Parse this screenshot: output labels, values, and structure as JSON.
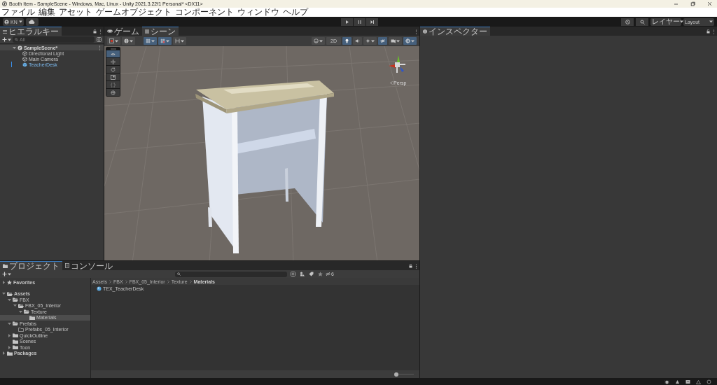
{
  "window": {
    "title": "Booth Item - SampleScene - Windows, Mac, Linux - Unity 2021.3.22f1 Personal* <DX11>"
  },
  "menu": [
    "ファイル",
    "編集",
    "アセット",
    "ゲームオブジェクト",
    "コンポーネント",
    "ウィンドウ",
    "ヘルプ"
  ],
  "toolbar": {
    "account": "KN",
    "layers": "レイヤー",
    "layout": "Layout"
  },
  "hierarchy": {
    "tab": "ヒエラルキー",
    "search_placeholder": "All",
    "tree": [
      {
        "label": "SampleScene*",
        "kind": "scene",
        "expanded": true,
        "modified": false,
        "children": [
          {
            "label": "Directional Light",
            "kind": "object",
            "modified": false
          },
          {
            "label": "Main Camera",
            "kind": "object",
            "modified": false
          },
          {
            "label": "TeacherDesk",
            "kind": "prefab",
            "modified": true
          }
        ]
      }
    ]
  },
  "scene": {
    "tabs": [
      {
        "label": "ゲーム",
        "kind": "game",
        "selected": false
      },
      {
        "label": "シーン",
        "kind": "scene",
        "selected": true
      }
    ],
    "toolbar": [
      {
        "kind": "drawmode",
        "dropdown": true,
        "selected": false
      },
      {
        "kind": "layers",
        "dropdown": true,
        "selected": false
      },
      {
        "kind": "gridsnap",
        "dropdown": true,
        "selected": true
      },
      {
        "kind": "incsnap",
        "dropdown": true,
        "selected": true
      },
      {
        "kind": "align",
        "dropdown": true,
        "selected": false
      },
      {
        "kind": "shading",
        "dropdown": true,
        "selected": false
      },
      {
        "kind": "mode2d",
        "label": "2D",
        "dropdown": false,
        "selected": false
      },
      {
        "kind": "lighting",
        "dropdown": false,
        "selected": true
      },
      {
        "kind": "audio",
        "dropdown": false,
        "selected": false
      },
      {
        "kind": "effects",
        "dropdown": true,
        "selected": false
      },
      {
        "kind": "visibility",
        "dropdown": false,
        "selected": true
      },
      {
        "kind": "camera",
        "dropdown": true,
        "selected": false
      },
      {
        "kind": "gizmos",
        "dropdown": true,
        "selected": true
      }
    ],
    "tools": [
      {
        "kind": "view",
        "selected": true
      },
      {
        "kind": "move",
        "selected": false
      },
      {
        "kind": "rotate",
        "selected": false
      },
      {
        "kind": "scale",
        "selected": false
      },
      {
        "kind": "rect",
        "selected": false
      },
      {
        "kind": "transform",
        "selected": false
      }
    ],
    "projection": "Persp"
  },
  "inspector": {
    "tab": "インスペクター"
  },
  "project": {
    "tabs": [
      {
        "label": "プロジェクト",
        "kind": "project",
        "selected": true
      },
      {
        "label": "コンソール",
        "kind": "console",
        "selected": false
      }
    ],
    "tree": [
      {
        "label": "Favorites",
        "kind": "favorites",
        "expandable": true,
        "expanded": false,
        "selected": false
      },
      {
        "label": "Assets",
        "kind": "root",
        "expandable": true,
        "expanded": true,
        "selected": false,
        "children": [
          {
            "label": "FBX",
            "kind": "folder",
            "expandable": true,
            "expanded": true,
            "selected": false,
            "children": [
              {
                "label": "FBX_05_Interior",
                "kind": "folder",
                "expandable": true,
                "expanded": true,
                "selected": false,
                "children": [
                  {
                    "label": "Texture",
                    "kind": "folder",
                    "expandable": true,
                    "expanded": true,
                    "selected": false,
                    "children": [
                      {
                        "label": "Materials",
                        "kind": "folder",
                        "expandable": false,
                        "expanded": false,
                        "selected": true
                      }
                    ]
                  }
                ]
              }
            ]
          },
          {
            "label": "Prefabs",
            "kind": "folder",
            "expandable": true,
            "expanded": true,
            "selected": false,
            "children": [
              {
                "label": "Prefabs_05_Interior",
                "kind": "empty",
                "expandable": false,
                "expanded": false,
                "selected": false
              }
            ]
          },
          {
            "label": "QuickOutline",
            "kind": "folder",
            "expandable": true,
            "expanded": false,
            "selected": false
          },
          {
            "label": "Scenes",
            "kind": "folder",
            "expandable": false,
            "expanded": false,
            "selected": false
          },
          {
            "label": "Toon",
            "kind": "folder",
            "expandable": true,
            "expanded": false,
            "selected": false
          }
        ]
      },
      {
        "label": "Packages",
        "kind": "root",
        "expandable": true,
        "expanded": false,
        "selected": false
      }
    ],
    "breadcrumbs": [
      "Assets",
      "FBX",
      "FBX_05_Interior",
      "Texture",
      "Materials"
    ],
    "assets": [
      {
        "label": "TEX_TeacherDesk"
      }
    ],
    "hidden_packages": "6",
    "zoom_slider": {
      "level": 0
    }
  }
}
